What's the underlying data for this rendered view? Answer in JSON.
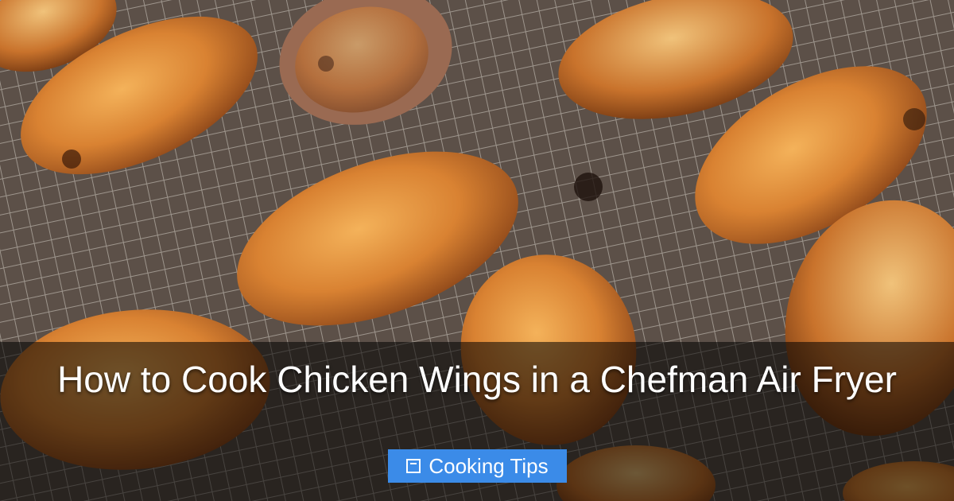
{
  "hero": {
    "title": "How to Cook Chicken Wings in a Chefman Air Fryer",
    "category": {
      "label": "Cooking Tips",
      "icon": "category-icon"
    }
  },
  "colors": {
    "badge_background": "#3b8be8",
    "overlay": "rgba(0,0,0,0.55)",
    "title_text": "#ffffff"
  }
}
